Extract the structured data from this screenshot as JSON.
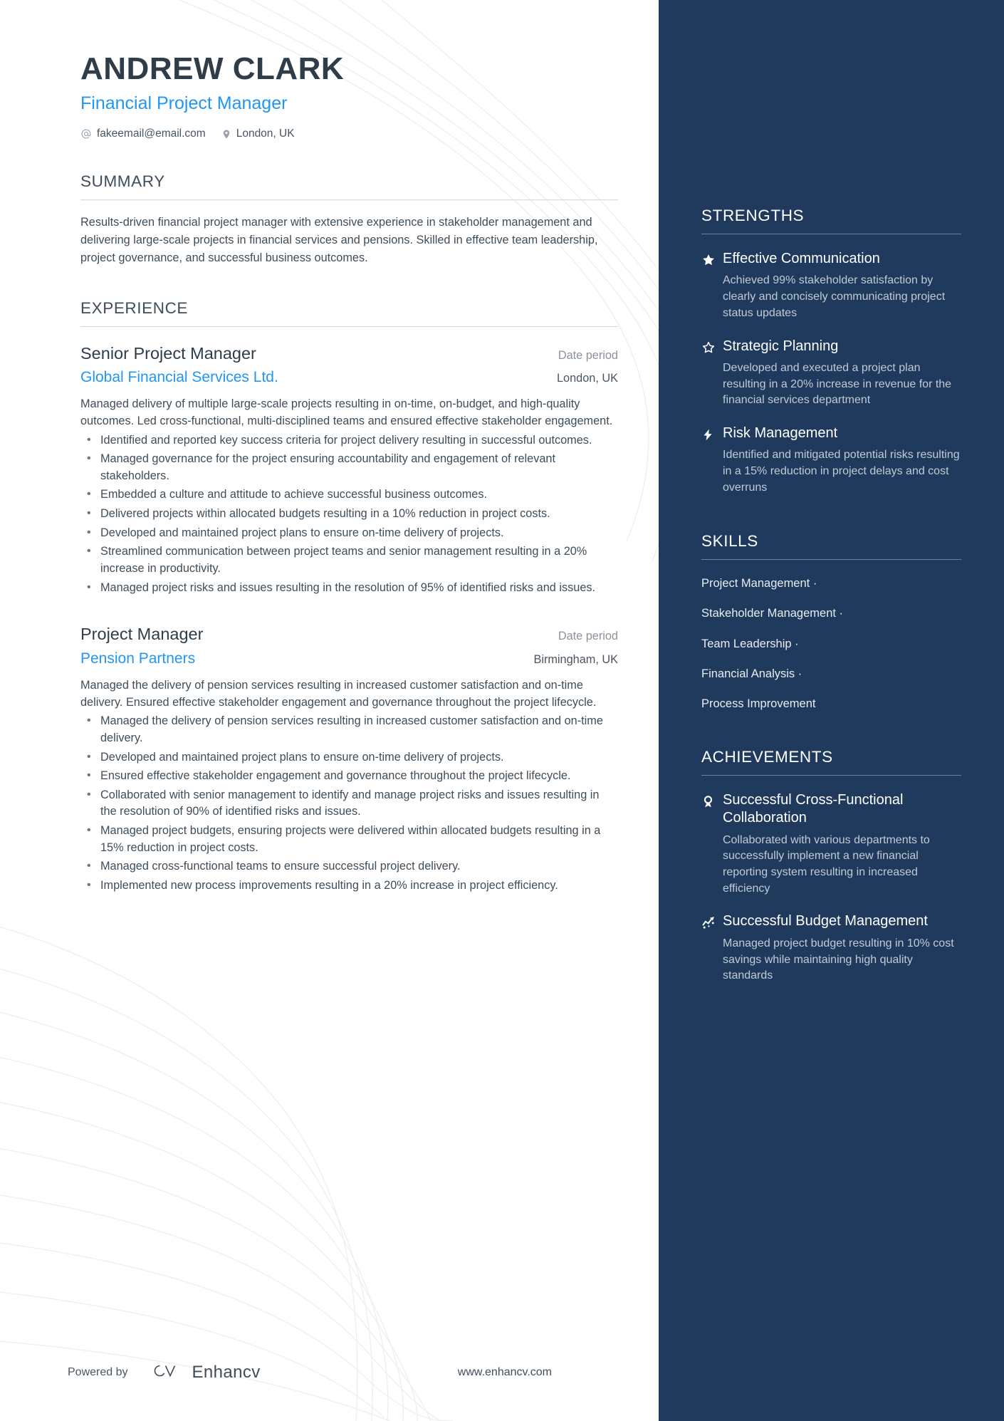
{
  "header": {
    "name": "ANDREW CLARK",
    "role": "Financial Project Manager",
    "email": "fakeemail@email.com",
    "location": "London, UK",
    "email_icon": "at-sign-icon",
    "location_icon": "map-pin-icon"
  },
  "summary": {
    "title": "SUMMARY",
    "text": "Results-driven financial project manager with extensive experience in stakeholder management and delivering large-scale projects in financial services and pensions. Skilled in effective team leadership, project governance, and successful business outcomes."
  },
  "experience": {
    "title": "EXPERIENCE",
    "entries": [
      {
        "title": "Senior Project Manager",
        "date": "Date period",
        "company": "Global Financial Services Ltd.",
        "location": "London, UK",
        "description": "Managed delivery of multiple large-scale projects resulting in on-time, on-budget, and high-quality outcomes. Led cross-functional, multi-disciplined teams and ensured effective stakeholder engagement.",
        "bullets": [
          "Identified and reported key success criteria for project delivery resulting in successful outcomes.",
          "Managed governance for the project ensuring accountability and engagement of relevant stakeholders.",
          "Embedded a culture and attitude to achieve successful business outcomes.",
          "Delivered projects within allocated budgets resulting in a 10% reduction in project costs.",
          "Developed and maintained project plans to ensure on-time delivery of projects.",
          "Streamlined communication between project teams and senior management resulting in a 20% increase in productivity.",
          "Managed project risks and issues resulting in the resolution of 95% of identified risks and issues."
        ]
      },
      {
        "title": "Project Manager",
        "date": "Date period",
        "company": "Pension Partners",
        "location": "Birmingham, UK",
        "description": "Managed the delivery of pension services resulting in increased customer satisfaction and on-time delivery. Ensured effective stakeholder engagement and governance throughout the project lifecycle.",
        "bullets": [
          "Managed the delivery of pension services resulting in increased customer satisfaction and on-time delivery.",
          "Developed and maintained project plans to ensure on-time delivery of projects.",
          "Ensured effective stakeholder engagement and governance throughout the project lifecycle.",
          "Collaborated with senior management to identify and manage project risks and issues resulting in the resolution of 90% of identified risks and issues.",
          "Managed project budgets, ensuring projects were delivered within allocated budgets resulting in a 15% reduction in project costs.",
          "Managed cross-functional teams to ensure successful project delivery.",
          "Implemented new process improvements resulting in a 20% increase in project efficiency."
        ]
      }
    ]
  },
  "strengths": {
    "title": "STRENGTHS",
    "items": [
      {
        "icon": "star-filled-icon",
        "title": "Effective Communication",
        "desc": "Achieved 99% stakeholder satisfaction by clearly and concisely communicating project status updates"
      },
      {
        "icon": "star-outline-icon",
        "title": "Strategic Planning",
        "desc": "Developed and executed a project plan resulting in a 20% increase in revenue for the financial services department"
      },
      {
        "icon": "lightning-bolt-icon",
        "title": "Risk Management",
        "desc": "Identified and mitigated potential risks resulting in a 15% reduction in project delays and cost overruns"
      }
    ]
  },
  "skills": {
    "title": "SKILLS",
    "items": [
      "Project Management ·",
      "Stakeholder Management ·",
      "Team Leadership ·",
      "Financial Analysis ·",
      "Process Improvement"
    ]
  },
  "achievements": {
    "title": "ACHIEVEMENTS",
    "items": [
      {
        "icon": "award-ribbon-icon",
        "title": "Successful Cross-Functional Collaboration",
        "desc": "Collaborated with various departments to successfully implement a new financial reporting system resulting in increased efficiency"
      },
      {
        "icon": "trending-up-icon",
        "title": "Successful Budget Management",
        "desc": "Managed project budget resulting in 10% cost savings while maintaining high quality standards"
      }
    ]
  },
  "footer": {
    "powered_by": "Powered by",
    "brand": "Enhancv",
    "brand_logo_icon": "enhancv-logo-icon",
    "url": "www.enhancv.com"
  },
  "colors": {
    "accent_blue": "#2196f3",
    "sidebar_bg": "#1f3a5c",
    "heading_dark": "#2e3d49",
    "body_text": "#3f4d59",
    "muted": "#8a939c"
  }
}
